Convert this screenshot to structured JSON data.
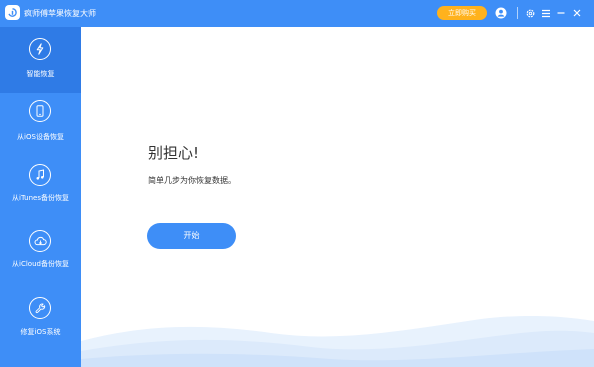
{
  "window": {
    "title": "疯师傅苹果恢复大师",
    "buy_label": "立即购买",
    "icons": [
      "app-logo-icon",
      "user-icon",
      "settings-icon",
      "menu-icon",
      "minimize-icon",
      "close-icon"
    ]
  },
  "sidebar": {
    "items": [
      {
        "label": "智能恢复",
        "icon": "lightning-icon",
        "active": true
      },
      {
        "label": "从iOS设备恢复",
        "icon": "phone-icon",
        "active": false
      },
      {
        "label": "从iTunes备份恢复",
        "icon": "music-note-icon",
        "active": false
      },
      {
        "label": "从iCloud备份恢复",
        "icon": "cloud-icon",
        "active": false
      },
      {
        "label": "修复iOS系统",
        "icon": "wrench-icon",
        "active": false
      }
    ]
  },
  "main": {
    "heading": "别担心!",
    "subtext": "简单几步为你恢复数据。",
    "start_label": "开始"
  },
  "colors": {
    "primary": "#3e8ef7",
    "active_item": "#2f7be6",
    "buy_button": "#ffb21d",
    "text": "#333333",
    "background": "#ffffff"
  }
}
